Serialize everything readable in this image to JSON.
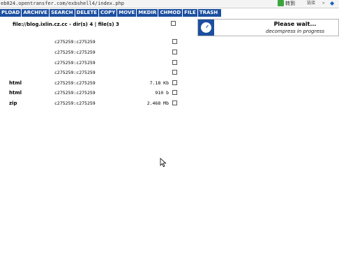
{
  "browser": {
    "address": "eb024.opentransfer.com/exbshell4/index.php",
    "go_label": "转到",
    "extra1": "链接",
    "extra2": "»"
  },
  "toolbar": {
    "items": [
      "PLOAD",
      "ARCHIVE",
      "SEARCH",
      "DELETE",
      "COPY",
      "MOVE",
      "MKDIR",
      "CHMOD",
      "FILE",
      "TRASH"
    ]
  },
  "path": {
    "text": "file://blog.ixlin.cz.cc - dir(s) 4 | file(s) 3"
  },
  "rows": [
    {
      "type": "",
      "owner": "c275259:c275259",
      "size": ""
    },
    {
      "type": "",
      "owner": "c275259:c275259",
      "size": ""
    },
    {
      "type": "",
      "owner": "c275259:c275259",
      "size": ""
    },
    {
      "type": "",
      "owner": "c275259:c275259",
      "size": ""
    },
    {
      "type": "html",
      "owner": "c275259:c275259",
      "size": "7.18 Kb"
    },
    {
      "type": "html",
      "owner": "c275259:c275259",
      "size": "910 b"
    },
    {
      "type": "zip",
      "owner": "c275259:c275259",
      "size": "2.468 Mb"
    }
  ],
  "status": {
    "title": "Please wait...",
    "message": "decompress in progress"
  },
  "colors": {
    "toolbar": "#1c4fa0"
  }
}
